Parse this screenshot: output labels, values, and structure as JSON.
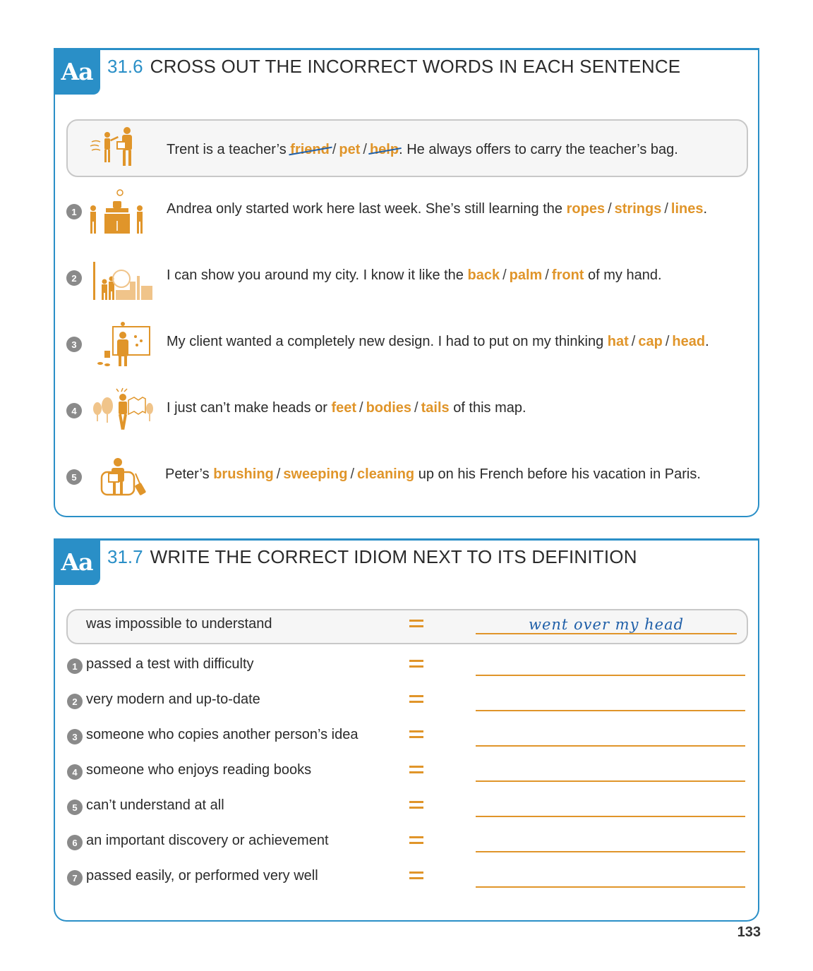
{
  "colors": {
    "accent_blue": "#2a8fc7",
    "option_orange": "#e0952a",
    "answer_blue": "#1f5fa8",
    "number_gray": "#8a8a8a"
  },
  "exercise1": {
    "badge": "Aa",
    "number": "31.6",
    "title": "CROSS OUT THE INCORRECT WORDS IN EACH SENTENCE",
    "example": {
      "icon": "teacher-student-icon",
      "before": "Trent is a teacher’s",
      "options": [
        "friend",
        "pet",
        "help"
      ],
      "after": ". He always offers to carry the teacher’s bag."
    },
    "items": [
      {
        "num": "1",
        "icon": "kitchen-workers-icon",
        "before": "Andrea only started work here last week. She’s still learning the",
        "options": [
          "ropes",
          "strings",
          "lines"
        ],
        "after": "."
      },
      {
        "num": "2",
        "icon": "city-tour-icon",
        "before": "I can show you around my city. I know it like the",
        "options": [
          "back",
          "palm",
          "front"
        ],
        "after": " of my hand."
      },
      {
        "num": "3",
        "icon": "designer-thinking-icon",
        "before": "My client wanted a completely new design. I had to put on my thinking",
        "options": [
          "hat",
          "cap",
          "head"
        ],
        "after": "."
      },
      {
        "num": "4",
        "icon": "confused-map-reader-icon",
        "before": "I just can’t make heads or",
        "options": [
          "feet",
          "bodies",
          "tails"
        ],
        "after": " of this map."
      },
      {
        "num": "5",
        "icon": "traveler-studying-icon",
        "before": "Peter’s",
        "options": [
          "brushing",
          "sweeping",
          "cleaning"
        ],
        "after": " up on his French before his vacation in Paris."
      }
    ]
  },
  "exercise2": {
    "badge": "Aa",
    "number": "31.7",
    "title": "WRITE THE CORRECT IDIOM NEXT TO ITS DEFINITION",
    "example": {
      "definition": "was impossible to understand",
      "answer": "went over my head"
    },
    "items": [
      {
        "num": "1",
        "definition": "passed a test with difficulty"
      },
      {
        "num": "2",
        "definition": "very modern and up-to-date"
      },
      {
        "num": "3",
        "definition": "someone who copies another person’s idea"
      },
      {
        "num": "4",
        "definition": "someone who enjoys reading books"
      },
      {
        "num": "5",
        "definition": "can’t understand at all"
      },
      {
        "num": "6",
        "definition": "an important discovery or achievement"
      },
      {
        "num": "7",
        "definition": "passed easily, or performed very well"
      }
    ]
  },
  "page_number": "133"
}
